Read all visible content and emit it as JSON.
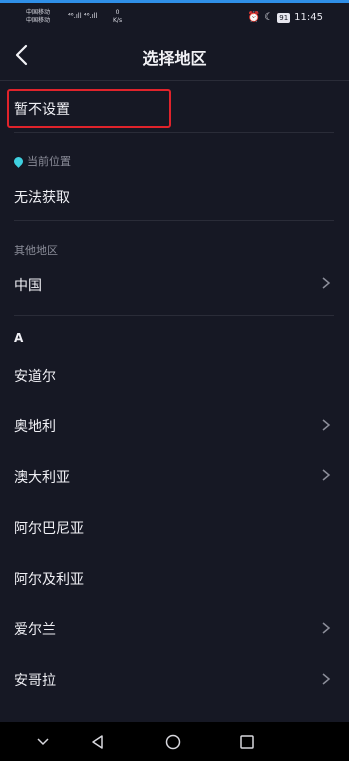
{
  "status": {
    "carrier1": "中国移动",
    "carrier2": "中国移动",
    "signal": "⁴⁶.ıll ⁴⁶.ıll",
    "speed_value": "0",
    "speed_unit": "K/s",
    "battery": "91",
    "time": "11:45"
  },
  "header": {
    "title": "选择地区"
  },
  "no_setting": "暂不设置",
  "current_location": {
    "label": "当前位置",
    "value": "无法获取"
  },
  "other_regions": {
    "label": "其他地区",
    "item": "中国"
  },
  "section_a": {
    "letter": "A",
    "items": [
      {
        "label": "安道尔"
      },
      {
        "label": "奥地利"
      },
      {
        "label": "澳大利亚"
      },
      {
        "label": "阿尔巴尼亚"
      },
      {
        "label": "阿尔及利亚"
      },
      {
        "label": "爱尔兰"
      },
      {
        "label": "安哥拉"
      }
    ]
  },
  "colors": {
    "background": "#161824",
    "highlight": "#e0232b",
    "accent": "#3fd0e0"
  }
}
